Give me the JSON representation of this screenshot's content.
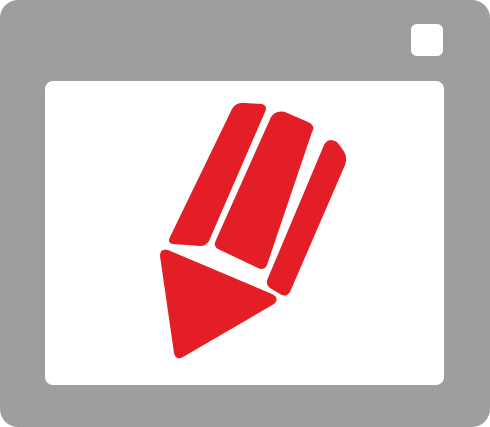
{
  "icon": {
    "name": "pencil-in-window-icon",
    "colors": {
      "frame": "#9d9e9d",
      "content": "#ffffff",
      "pencil": "#e31e26"
    }
  }
}
